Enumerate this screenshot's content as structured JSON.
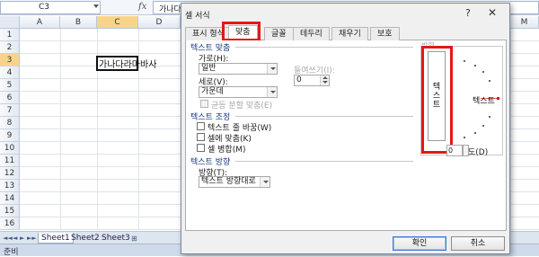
{
  "formula_bar": {
    "name_box": "C3",
    "fx_symbol": "fx",
    "content": "가나다라마바사"
  },
  "grid": {
    "columns": [
      "A",
      "B",
      "C",
      "D",
      "M"
    ],
    "selected_column": "C",
    "rows": [
      "1",
      "2",
      "3",
      "4",
      "5",
      "6",
      "7",
      "8",
      "9",
      "10",
      "11",
      "12",
      "13",
      "14",
      "15",
      "16"
    ],
    "selected_row": "3",
    "active_cell_text": "가나다라마바사"
  },
  "sheet_tabs": {
    "nav": [
      "◄◄",
      "◄",
      "►",
      "►►"
    ],
    "tabs": [
      "Sheet1",
      "Sheet2",
      "Sheet3"
    ],
    "active": "Sheet1"
  },
  "status_bar": {
    "text": "준비"
  },
  "dialog": {
    "title": "셀 서식",
    "help": "?",
    "close": "✕",
    "tabs": [
      "표시 형식",
      "맞춤",
      "글꼴",
      "테두리",
      "채우기",
      "보호"
    ],
    "active_tab": "맞춤",
    "text_alignment": {
      "group_label": "텍스트 맞춤",
      "horizontal_label": "가로(H):",
      "horizontal_value": "일반",
      "indent_label": "들여쓰기(I):",
      "indent_value": "0",
      "vertical_label": "세로(V):",
      "vertical_value": "가운데",
      "distributed_label": "균등 분할 맞춤(E)"
    },
    "text_control": {
      "group_label": "텍스트 조정",
      "wrap_text": "텍스트 줄 바꿈(W)",
      "shrink_to_fit": "셀에 맞춤(K)",
      "merge_cells": "셀 병합(M)"
    },
    "text_direction": {
      "group_label": "텍스트 방향",
      "direction_label": "방향(T):",
      "direction_value": "텍스트 방향대로"
    },
    "orientation": {
      "title": "방향",
      "vertical_text": "텍스트",
      "dial_text": "텍스트",
      "degrees_value": "0",
      "degrees_label": "도(D)"
    },
    "buttons": {
      "ok": "확인",
      "cancel": "취소"
    }
  }
}
